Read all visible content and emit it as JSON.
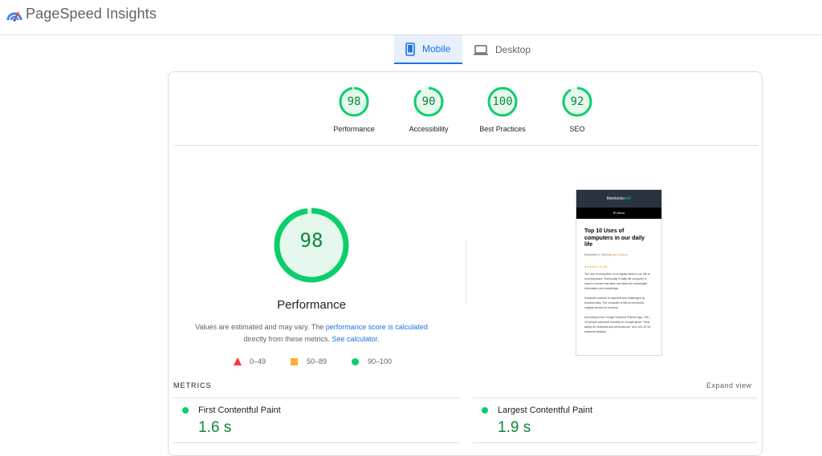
{
  "app": {
    "title": "PageSpeed Insights",
    "logo_icon": "pagespeed-logo-icon"
  },
  "tabs": [
    {
      "label": "Mobile",
      "icon": "phone-icon",
      "active": true
    },
    {
      "label": "Desktop",
      "icon": "laptop-icon",
      "active": false
    }
  ],
  "scores": [
    {
      "value": "98",
      "label": "Performance",
      "fraction": 0.98
    },
    {
      "value": "90",
      "label": "Accessibility",
      "fraction": 0.9
    },
    {
      "value": "100",
      "label": "Best Practices",
      "fraction": 1.0
    },
    {
      "value": "92",
      "label": "SEO",
      "fraction": 0.92
    }
  ],
  "performance": {
    "score": "98",
    "fraction": 0.98,
    "title": "Performance",
    "desc_part1": "Values are estimated and may vary. The ",
    "desc_link1": "performance score is calculated",
    "desc_part2": "directly from these metrics. ",
    "desc_link2": "See calculator."
  },
  "legend": [
    {
      "range": "0–49",
      "shape": "triangle",
      "color": "#ff3333"
    },
    {
      "range": "50–89",
      "shape": "square",
      "color": "#ffaa33"
    },
    {
      "range": "90–100",
      "shape": "circle",
      "color": "#0cce6b"
    }
  ],
  "screenshot": {
    "brand_part1": "klientsolu",
    "brand_part2": "tech",
    "menu": "☰ Menu",
    "title": "Top 10 Uses of computers in our daily life",
    "date": "November 2, 2019 by ",
    "author": "Ajay Sharma",
    "rating": "★★★★★ 4.6 (38)",
    "para1": "The use of computers on a regular basis in our life is very important. Technically in daily life computer is used to convert raw facts and data into meaningful information and knowledge.",
    "para2": "Computer science is explored and challenged by humans daily. The computer is like an electronic magical device for humans.",
    "para3": "According to the Google Keyword Planner app, 150 – 1K people searched monthly on Google about \" best laptop for business and personal use\" and 100-1K for business desktop"
  },
  "metrics": {
    "label": "METRICS",
    "expand": "Expand view",
    "items": [
      {
        "name": "First Contentful Paint",
        "value": "1.6 s",
        "status_color": "#0cce6b"
      },
      {
        "name": "Largest Contentful Paint",
        "value": "1.9 s",
        "status_color": "#0cce6b"
      }
    ]
  },
  "colors": {
    "accent": "#1a73e8",
    "pass": "#0cce6b",
    "pass_text": "#0a8a38",
    "gauge_fill": "#e6f8ee"
  }
}
